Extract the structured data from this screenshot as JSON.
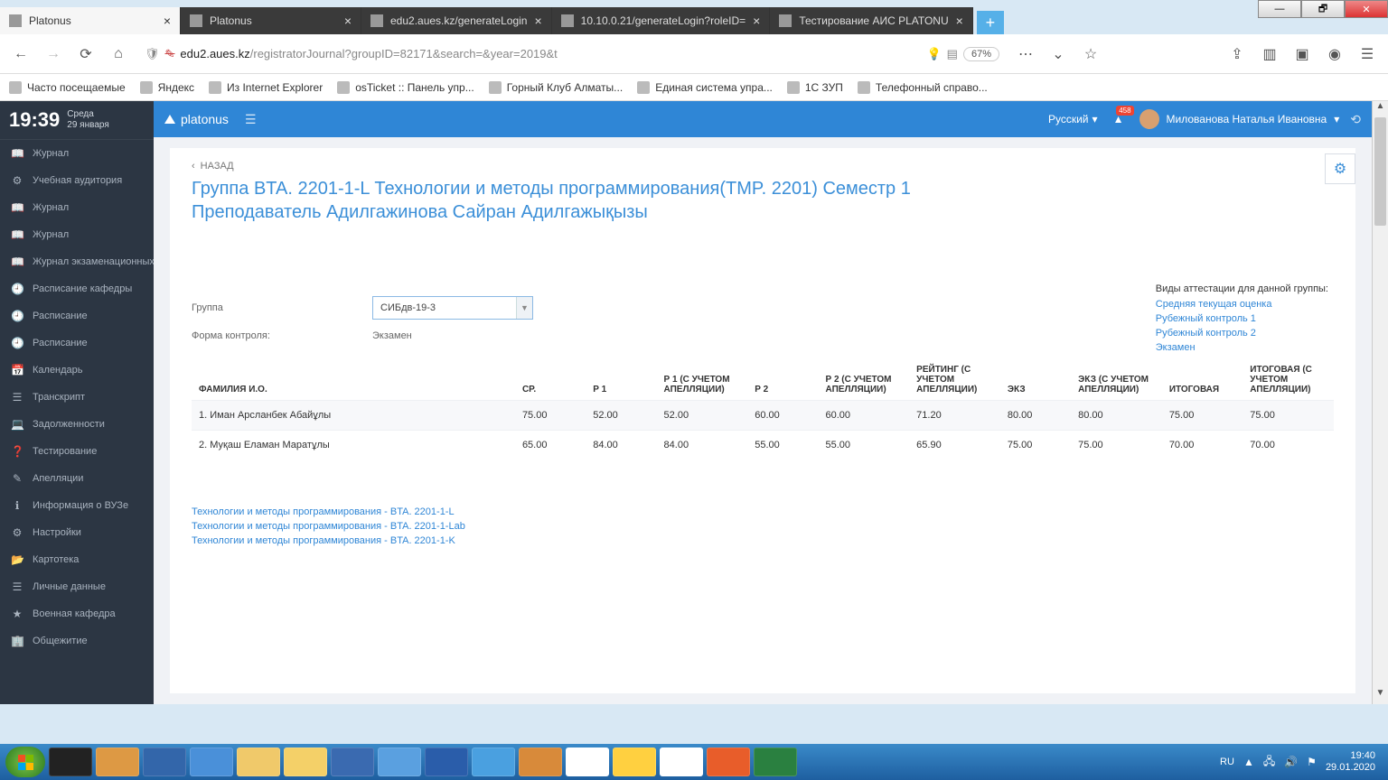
{
  "os": {
    "min": "—",
    "max": "🗗",
    "close": "✕"
  },
  "tabs": [
    {
      "title": "Platonus",
      "active": true
    },
    {
      "title": "Platonus",
      "active": false
    },
    {
      "title": "edu2.aues.kz/generateLogin",
      "active": false
    },
    {
      "title": "10.10.0.21/generateLogin?roleID=",
      "active": false
    },
    {
      "title": "Тестирование АИС PLATONU",
      "active": false
    }
  ],
  "url": {
    "host": "edu2.aues.kz",
    "path": "/registratorJournal?groupID=82171&search=&year=2019&t",
    "zoom": "67%"
  },
  "bookmarks": [
    "Часто посещаемые",
    "Яндекс",
    "Из Internet Explorer",
    "osTicket :: Панель упр...",
    "Горный Клуб Алматы...",
    "Единая система упра...",
    "1С ЗУП",
    "Телефонный справо..."
  ],
  "appbar": {
    "brand": "platonus",
    "lang": "Русский",
    "badge": "458",
    "user": "Милованова Наталья Ивановна"
  },
  "clock": {
    "time": "19:39",
    "weekday": "Среда",
    "date": "29 января"
  },
  "sidebar": [
    "Журнал",
    "Учебная аудитория",
    "Журнал",
    "Журнал",
    "Журнал экзаменационных",
    "Расписание кафедры",
    "Расписание",
    "Расписание",
    "Календарь",
    "Транскрипт",
    "Задолженности",
    "Тестирование",
    "Апелляции",
    "Информация о ВУЗе",
    "Настройки",
    "Картотека",
    "Личные данные",
    "Военная кафедра",
    "Общежитие"
  ],
  "sidebar_icons": [
    "📖",
    "⚙",
    "📖",
    "📖",
    "📖",
    "🕘",
    "🕘",
    "🕘",
    "📅",
    "☰",
    "💻",
    "❓",
    "✎",
    "ℹ",
    "⚙",
    "📂",
    "☰",
    "★",
    "🏢"
  ],
  "back": "НАЗАД",
  "title_l1": "Группа BTA. 2201-1-L Технологии и методы программирования(TMP. 2201) Семестр 1",
  "title_l2": "Преподаватель Адилгажинова Сайран Адилгажықызы",
  "att": {
    "header": "Виды аттестации для данной группы:",
    "links": [
      "Средняя текущая оценка",
      "Рубежный контроль 1",
      "Рубежный контроль 2",
      "Экзамен"
    ]
  },
  "form": {
    "group_lbl": "Группа",
    "group_val": "СИБдв-19-3",
    "control_lbl": "Форма контроля:",
    "control_val": "Экзамен"
  },
  "cols": [
    "ФАМИЛИЯ И.О.",
    "СР.",
    "Р 1",
    "Р 1 (С УЧЕТОМ АПЕЛЛЯЦИИ)",
    "Р 2",
    "Р 2 (С УЧЕТОМ АПЕЛЛЯЦИИ)",
    "РЕЙТИНГ (С УЧЕТОМ АПЕЛЛЯЦИИ)",
    "ЭКЗ",
    "ЭКЗ (С УЧЕТОМ АПЕЛЛЯЦИИ)",
    "ИТОГОВАЯ",
    "ИТОГОВАЯ (С УЧЕТОМ АПЕЛЛЯЦИИ)"
  ],
  "rows": [
    {
      "name": "1. Иман Арсланбек Абайұлы",
      "sr": "75.00",
      "r1": "52.00",
      "r1a": "52.00",
      "r2": "60.00",
      "r2a": "60.00",
      "rt": "71.20",
      "ex": "80.00",
      "exa": "80.00",
      "it": "75.00",
      "ita": "75.00"
    },
    {
      "name": "2. Муқаш Еламан Маратұлы",
      "sr": "65.00",
      "r1": "84.00",
      "r1a": "84.00",
      "r2": "55.00",
      "r2a": "55.00",
      "rt": "65.90",
      "ex": "75.00",
      "exa": "75.00",
      "it": "70.00",
      "ita": "70.00"
    }
  ],
  "foot_links": [
    "Технологии и методы программирования - BTA. 2201-1-L",
    "Технологии и методы программирования - BTA. 2201-1-Lab",
    "Технологии и методы программирования - BTA. 2201-1-K"
  ],
  "tray": {
    "lang": "RU",
    "time": "19:40",
    "date": "29.01.2020"
  }
}
